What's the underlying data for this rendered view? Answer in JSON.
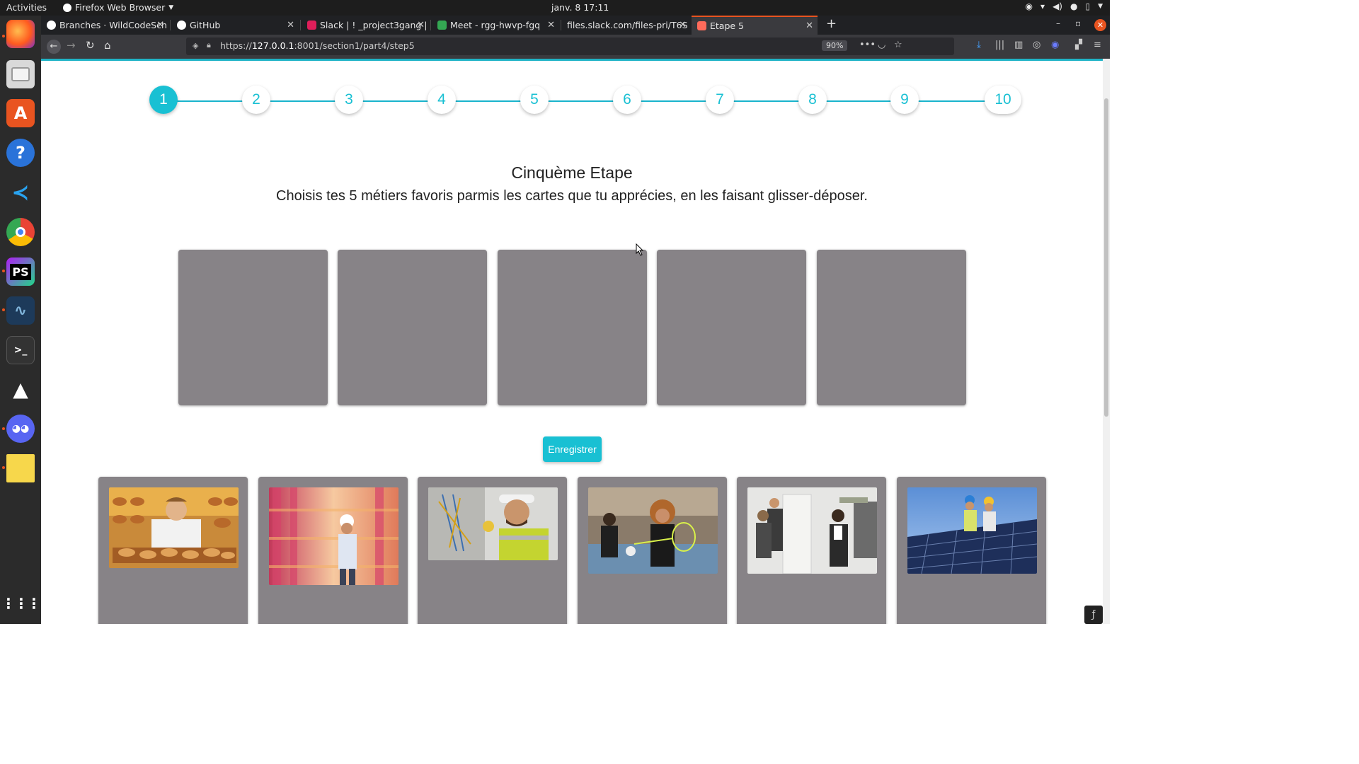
{
  "system_bar": {
    "activities": "Activities",
    "app_menu": "Firefox Web Browser",
    "clock": "janv. 8  17:11"
  },
  "tabs": [
    {
      "label": "Branches · WildCodeSch",
      "icon_color": "#ffffff"
    },
    {
      "label": "GitHub",
      "icon_color": "#ffffff"
    },
    {
      "label": "Slack | ! _project3gang | \\",
      "icon_color": "#e01e5a"
    },
    {
      "label": "Meet - rgg-hwvp-fgq",
      "icon_color": "#34a853"
    },
    {
      "label": "files.slack.com/files-pri/T6S",
      "icon_color": ""
    },
    {
      "label": "Etape 5",
      "icon_color": "#ff6b5b",
      "active": true
    }
  ],
  "nav": {
    "url_prefix": "https://",
    "url_host": "127.0.0.1",
    "url_rest": ":8001/section1/part4/step5",
    "zoom": "90%"
  },
  "stepper": {
    "steps": [
      "1",
      "2",
      "3",
      "4",
      "5",
      "6",
      "7",
      "8",
      "9",
      "10"
    ],
    "active_step": "1"
  },
  "main": {
    "title": "Cinquème Etape",
    "subtitle": "Choisis tes 5 métiers favoris parmis les cartes que tu apprécies, en les faisant glisser-déposer.",
    "save_label": "Enregistrer"
  },
  "colors": {
    "accent": "#19c0d3",
    "slot_gray": "#878387"
  },
  "cards": [
    {
      "name": "baker-card"
    },
    {
      "name": "warehouse-card"
    },
    {
      "name": "electrician-card"
    },
    {
      "name": "sports-teacher-card"
    },
    {
      "name": "real-estate-card"
    },
    {
      "name": "solar-technician-card"
    }
  ]
}
